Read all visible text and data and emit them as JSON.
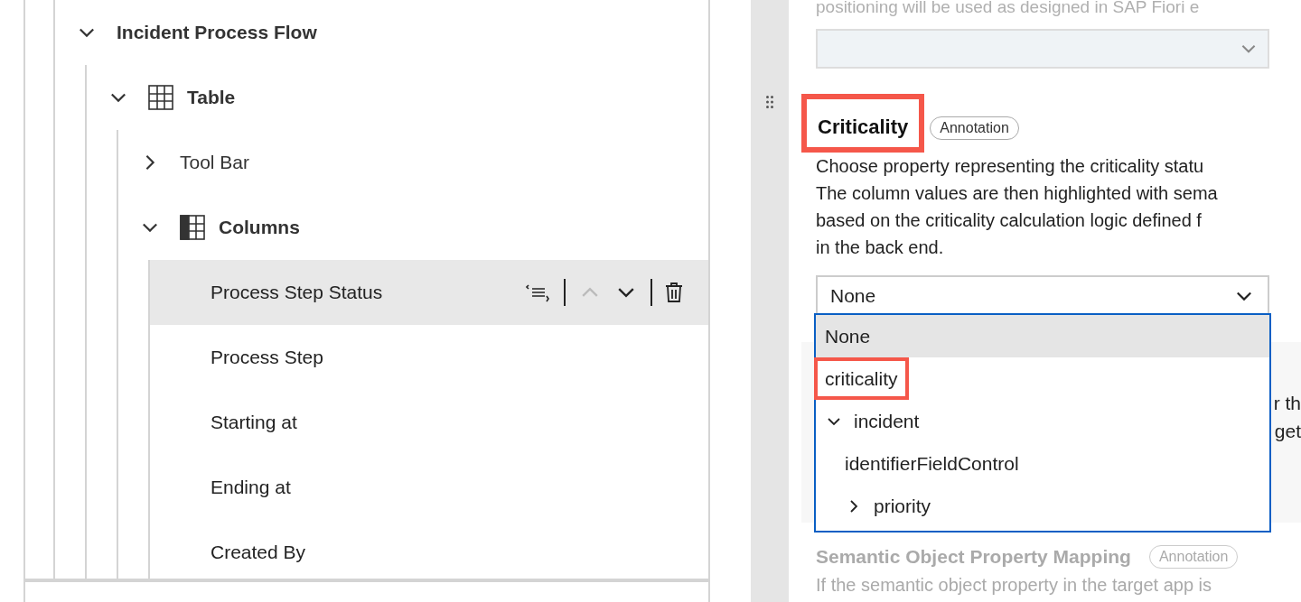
{
  "tree": [
    {
      "label": "Incident Process Flow",
      "expanded": true,
      "children": [
        {
          "label": "Table",
          "kind": "table",
          "expanded": true,
          "children": [
            {
              "label": "Tool Bar",
              "kind": "plain",
              "expanded": false
            },
            {
              "label": "Columns",
              "kind": "columns",
              "expanded": true,
              "children": [
                {
                  "label": "Process Step Status",
                  "selected": true
                },
                {
                  "label": "Process Step",
                  "selected": false
                },
                {
                  "label": "Starting at",
                  "selected": false
                },
                {
                  "label": "Ending at",
                  "selected": false
                },
                {
                  "label": "Created By",
                  "selected": false
                }
              ]
            }
          ]
        }
      ]
    }
  ],
  "properties": {
    "top_text": "positioning will be used as designed in SAP Fiori e",
    "criticality": {
      "title": "Criticality",
      "highlighted": true,
      "badge": "Annotation",
      "description": "Choose property representing the criticality statu\nThe column values are then highlighted with sema\nbased on the criticality calculation logic defined f\nin the back end.",
      "value": "None"
    },
    "dropdown": {
      "options": [
        {
          "label": "None",
          "selected": true,
          "highlighted": false
        },
        {
          "label": "criticality",
          "selected": false,
          "highlighted": true
        },
        {
          "label": "incident",
          "selected": false,
          "highlighted": false,
          "expanded": true,
          "children": [
            {
              "label": "identifierFieldControl",
              "selected": false,
              "highlighted": false
            },
            {
              "label": "priority",
              "selected": false,
              "highlighted": false,
              "expanded": false
            }
          ]
        }
      ]
    },
    "hidden_text": [
      "r th",
      "get"
    ],
    "semantic": {
      "title": "Semantic Object Property Mapping",
      "badge": "Annotation",
      "description": "If the semantic object property in the target app is",
      "disabled": true
    }
  }
}
